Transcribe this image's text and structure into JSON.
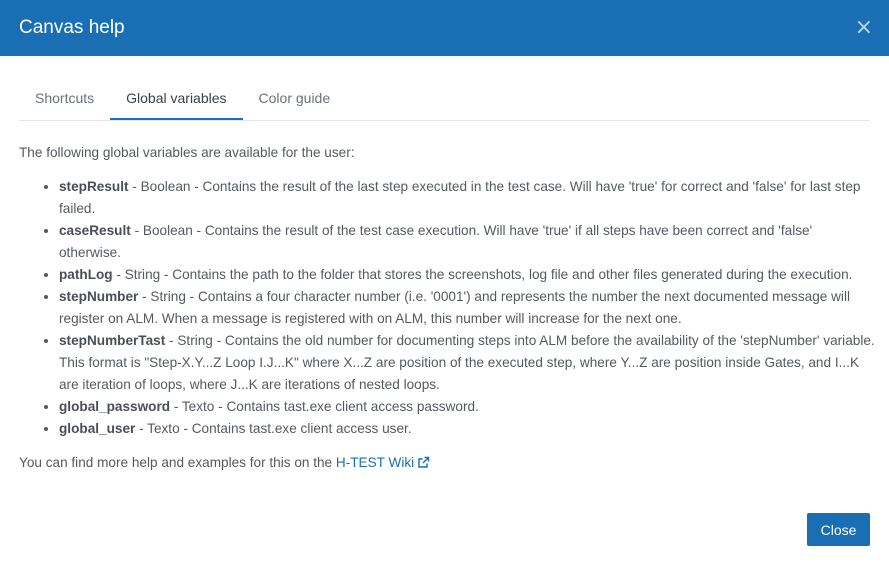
{
  "dialog": {
    "title": "Canvas help",
    "close_symbol": "×"
  },
  "tabs": [
    {
      "label": "Shortcuts",
      "active": false
    },
    {
      "label": "Global variables",
      "active": true
    },
    {
      "label": "Color guide",
      "active": false
    }
  ],
  "content": {
    "intro": "The following global variables are available for the user:",
    "variables": [
      {
        "name": "stepResult",
        "desc": " - Boolean - Contains the result of the last step executed in the test case. Will have 'true' for correct and 'false' for last step failed."
      },
      {
        "name": "caseResult",
        "desc": " - Boolean - Contains the result of the test case execution. Will have 'true' if all steps have been correct and 'false' otherwise."
      },
      {
        "name": "pathLog",
        "desc": " - String - Contains the path to the folder that stores the screenshots, log file and other files generated during the execution."
      },
      {
        "name": "stepNumber",
        "desc": " - String - Contains a four character number (i.e. '0001') and represents the number the next documented message will register on ALM. When a message is registered with on ALM, this number will increase for the next one."
      },
      {
        "name": "stepNumberTast",
        "desc": " - String - Contains the old number for documenting steps into ALM before the availability of the 'stepNumber' variable. This format is \"Step-X.Y...Z Loop I.J...K\" where X...Z are position of the executed step, where Y...Z are position inside Gates, and I...K are iteration of loops, where J...K are iterations of nested loops."
      },
      {
        "name": "global_password",
        "desc": " - Texto - Contains tast.exe client access password."
      },
      {
        "name": "global_user",
        "desc": " - Texto - Contains tast.exe client access user."
      }
    ],
    "footer_prefix": "You can find more help and examples for this on the ",
    "wiki_link": "H-TEST Wiki",
    "link_icon": "external-link-icon"
  },
  "buttons": {
    "close": "Close"
  },
  "colors": {
    "header_bg": "#1a6fb4",
    "accent": "#1a6fb4"
  }
}
